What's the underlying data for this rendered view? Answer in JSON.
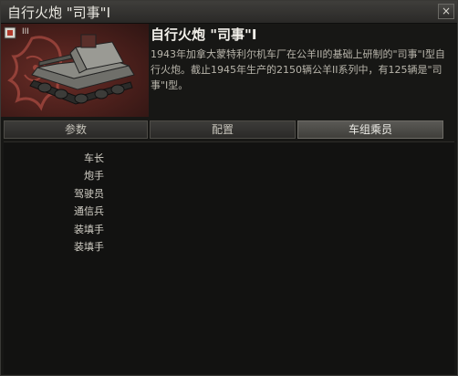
{
  "window": {
    "title": "自行火炮 \"司事\"I",
    "close_glyph": "×"
  },
  "vehicle": {
    "tier": "III",
    "name": "自行火炮 \"司事\"I",
    "description": "1943年加拿大蒙特利尔机车厂在公羊II的基础上研制的\"司事\"I型自行火炮。截止1945年生产的2150辆公羊II系列中，有125辆是\"司事\"I型。",
    "nation_emblem_color": "#c95a4f"
  },
  "tabs": [
    {
      "label": "参数",
      "active": false
    },
    {
      "label": "配置",
      "active": false
    },
    {
      "label": "车组乘员",
      "active": true
    }
  ],
  "crew": {
    "roles": [
      "车长",
      "炮手",
      "驾驶员",
      "通信兵",
      "装填手",
      "装填手"
    ]
  },
  "colors": {
    "background": "#171715",
    "panel_red": "#4a1f1b",
    "active_tab": "#5a5955",
    "text_main": "#d3d0c7"
  }
}
